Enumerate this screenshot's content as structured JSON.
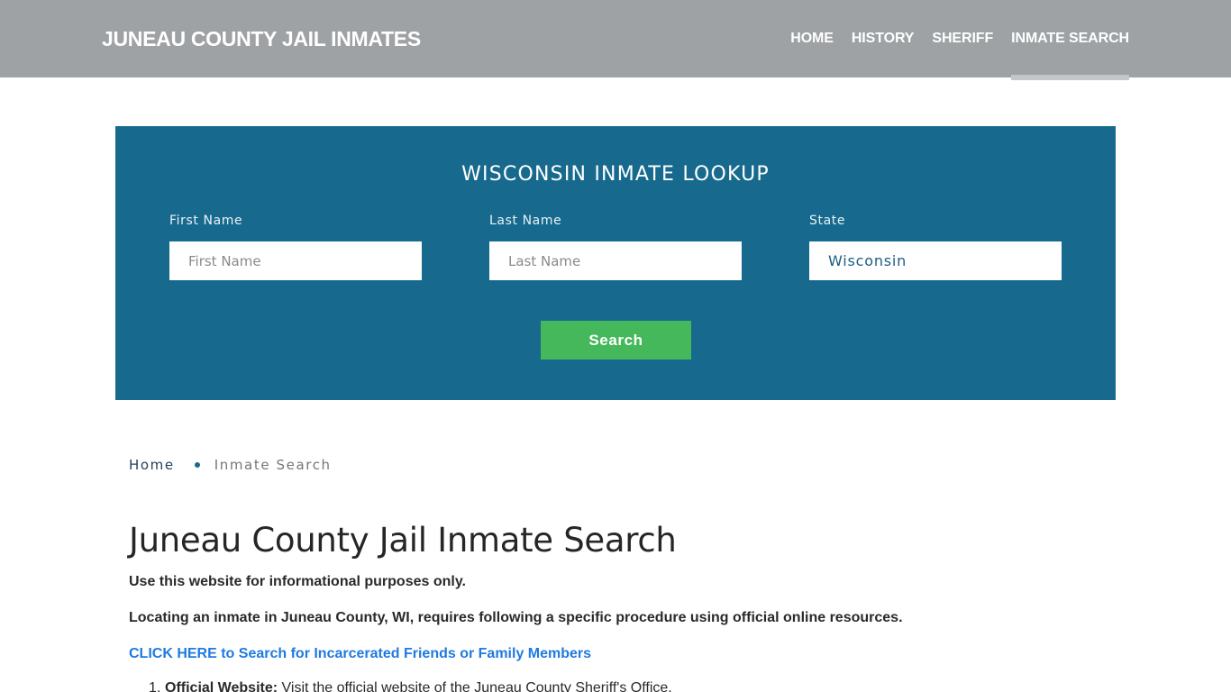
{
  "header": {
    "brand": "JUNEAU COUNTY JAIL INMATES",
    "nav": [
      {
        "label": "HOME",
        "active": false
      },
      {
        "label": "HISTORY",
        "active": false
      },
      {
        "label": "SHERIFF",
        "active": false
      },
      {
        "label": "INMATE SEARCH",
        "active": true
      }
    ]
  },
  "lookup": {
    "title": "WISCONSIN INMATE LOOKUP",
    "first_name": {
      "label": "First Name",
      "placeholder": "First Name",
      "value": ""
    },
    "last_name": {
      "label": "Last Name",
      "placeholder": "Last Name",
      "value": ""
    },
    "state": {
      "label": "State",
      "value": "Wisconsin"
    },
    "search_label": "Search",
    "colors": {
      "panel": "#176a8d",
      "button": "#44b85a"
    }
  },
  "breadcrumb": {
    "home": "Home",
    "current": "Inmate Search"
  },
  "main": {
    "title": "Juneau County Jail Inmate Search",
    "disclaimer": "Use this website for informational purposes only.",
    "intro": "Locating an inmate in Juneau County, WI, requires following a specific procedure using official online resources.",
    "cta_link": "CLICK HERE to Search for Incarcerated Friends or Family Members",
    "steps": [
      {
        "number": "1.",
        "title": "Official Website:",
        "text": " Visit the official website of the Juneau County Sheriff's Office."
      }
    ]
  }
}
